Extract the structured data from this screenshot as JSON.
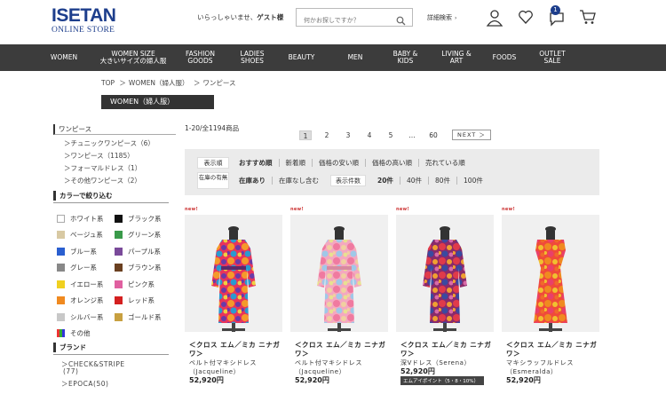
{
  "header": {
    "logo_main": "ISETAN",
    "logo_sub": "ONLINE STORE",
    "welcome_prefix": "いらっしゃいませ、",
    "welcome_user": "ゲスト様",
    "search_placeholder": "何かお探しですか？",
    "advanced_search": "詳細検索",
    "notification_count": "1"
  },
  "nav": [
    {
      "label": "WOMEN"
    },
    {
      "label": "WOMEN SIZE\n大きいサイズの婦人服"
    },
    {
      "label": "FASHION\nGOODS"
    },
    {
      "label": "LADIES\nSHOES"
    },
    {
      "label": "BEAUTY"
    },
    {
      "label": "MEN"
    },
    {
      "label": "BABY &\nKIDS"
    },
    {
      "label": "LIVING &\nART"
    },
    {
      "label": "FOODS"
    },
    {
      "label": "OUTLET\nSALE"
    }
  ],
  "breadcrumb": {
    "top": "TOP",
    "sep1": "＞",
    "women": "WOMEN（婦人服）",
    "sep2": "＞",
    "current": "ワンピース"
  },
  "category_title": "WOMEN（婦人服）",
  "sidebar": {
    "category": "ワンピース",
    "subcategories": [
      "＞チュニックワンピース（6）",
      "＞ワンピース（1185）",
      "＞フォーマルドレス（1）",
      "＞その他ワンピース（2）"
    ],
    "color_heading": "カラーで絞り込む",
    "colors": [
      {
        "name": "ホワイト系",
        "hex": "#ffffff"
      },
      {
        "name": "ブラック系",
        "hex": "#111111"
      },
      {
        "name": "ベージュ系",
        "hex": "#d8c9a3"
      },
      {
        "name": "グリーン系",
        "hex": "#3a9a4a"
      },
      {
        "name": "ブルー系",
        "hex": "#2a5fd0"
      },
      {
        "name": "パープル系",
        "hex": "#7a4a9a"
      },
      {
        "name": "グレー系",
        "hex": "#888888"
      },
      {
        "name": "ブラウン系",
        "hex": "#6a4020"
      },
      {
        "name": "イエロー系",
        "hex": "#f0d020"
      },
      {
        "name": "ピンク系",
        "hex": "#e060a0"
      },
      {
        "name": "オレンジ系",
        "hex": "#f08a20"
      },
      {
        "name": "レッド系",
        "hex": "#d42020"
      },
      {
        "name": "シルバー系",
        "hex": "#c8c8c8"
      },
      {
        "name": "ゴールド系",
        "hex": "#c8a040"
      },
      {
        "name": "その他",
        "hex": "multi"
      }
    ],
    "brand_heading": "ブランド",
    "brands": [
      "＞CHECK&STRIPE",
      "(77)",
      "＞EPOCA(50)"
    ]
  },
  "results": {
    "count": "1-20/全1194商品",
    "pages": [
      "1",
      "2",
      "3",
      "4",
      "5",
      "…",
      "60"
    ],
    "next": "NEXT ＞"
  },
  "filters": {
    "sort_label": "表示順",
    "sort_options": [
      "おすすめ順",
      "新着順",
      "価格の安い順",
      "価格の高い順",
      "売れている順"
    ],
    "stock_label": "在庫の有無",
    "stock_options": [
      "在庫あり",
      "在庫なし含む"
    ],
    "per_page_label": "表示件数",
    "per_page_options": [
      "20件",
      "40件",
      "80件",
      "100件"
    ]
  },
  "products": [
    {
      "new": "new!",
      "brand": "＜クロス エム／ミカ ニナガワ＞",
      "name": "ベルト付マキシドレス（Jacqueline）",
      "price": "52,920円",
      "point": "",
      "palette": [
        "#e8345a",
        "#f59a2a",
        "#6a3aa8",
        "#2a9ad0",
        "#f0d040"
      ]
    },
    {
      "new": "new!",
      "brand": "＜クロス エム／ミカ ニナガワ＞",
      "name": "ベルト付マキシドレス（Jacqueline）",
      "price": "52,920円",
      "point": "",
      "palette": [
        "#f4a8c0",
        "#f07aa0",
        "#f0d0a0",
        "#a0c8e8",
        "#e8e090"
      ]
    },
    {
      "new": "new!",
      "brand": "＜クロス エム／ミカ ニナガワ＞",
      "name": "深Vドレス（Serena）",
      "price": "52,920円",
      "point": "エムアイポイント（5・8・10%）",
      "palette": [
        "#8a2a6a",
        "#e03a4a",
        "#f0a030",
        "#3a4aa0",
        "#d86aa8"
      ]
    },
    {
      "new": "new!",
      "brand": "＜クロス エム／ミカ ニナガワ＞",
      "name": "マキシラッフルドレス（Esmeralda）",
      "price": "52,920円",
      "point": "",
      "palette": [
        "#f04a3a",
        "#f08a20",
        "#f0c030",
        "#e8406a",
        "#f06a2a"
      ]
    }
  ]
}
